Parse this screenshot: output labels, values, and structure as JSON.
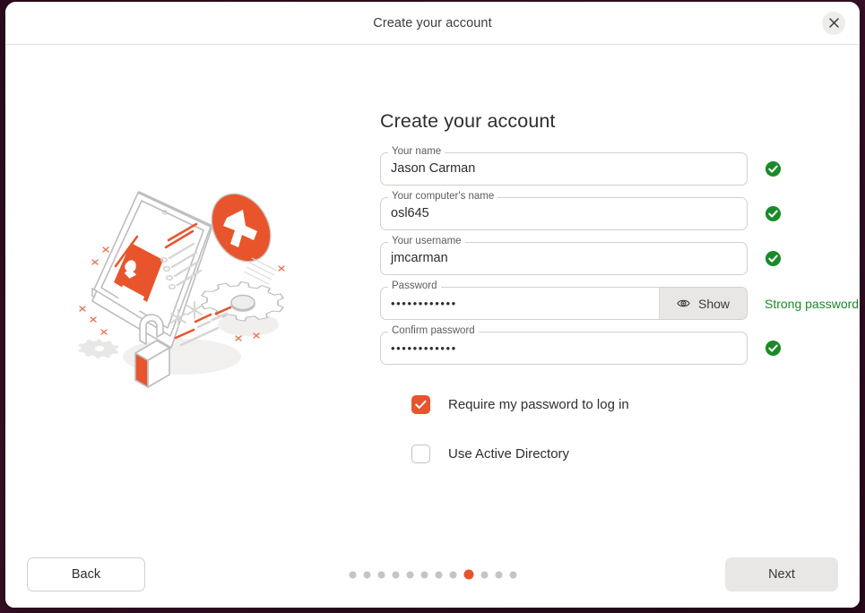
{
  "window": {
    "title": "Create your account",
    "close_icon": "close-icon"
  },
  "form": {
    "heading": "Create your account",
    "fields": [
      {
        "label": "Your name",
        "value": "Jason Carman",
        "status": "valid"
      },
      {
        "label": "Your computer's name",
        "value": "osl645",
        "status": "valid"
      },
      {
        "label": "Your username",
        "value": "jmcarman",
        "status": "valid"
      }
    ],
    "password": {
      "label": "Password",
      "value": "••••••••••••",
      "show_button_label": "Show",
      "show_button_icon": "eye-icon",
      "strength_text": "Strong password",
      "strength_color": "#1a8a28"
    },
    "confirm_password": {
      "label": "Confirm password",
      "value": "••••••••••••",
      "status": "valid"
    },
    "checkboxes": [
      {
        "label": "Require my password to log in",
        "checked": true
      },
      {
        "label": "Use Active Directory",
        "checked": false
      }
    ]
  },
  "footer": {
    "back_label": "Back",
    "next_label": "Next",
    "pager": {
      "total": 12,
      "active_index": 9
    }
  },
  "colors": {
    "accent": "#e8552d",
    "valid": "#1a8a28",
    "desktop": "#2e0c20"
  },
  "illustration": {
    "name": "create-account-illustration",
    "description": "isometric monitor with user profile card, orange plus badge, gear and padlock"
  }
}
